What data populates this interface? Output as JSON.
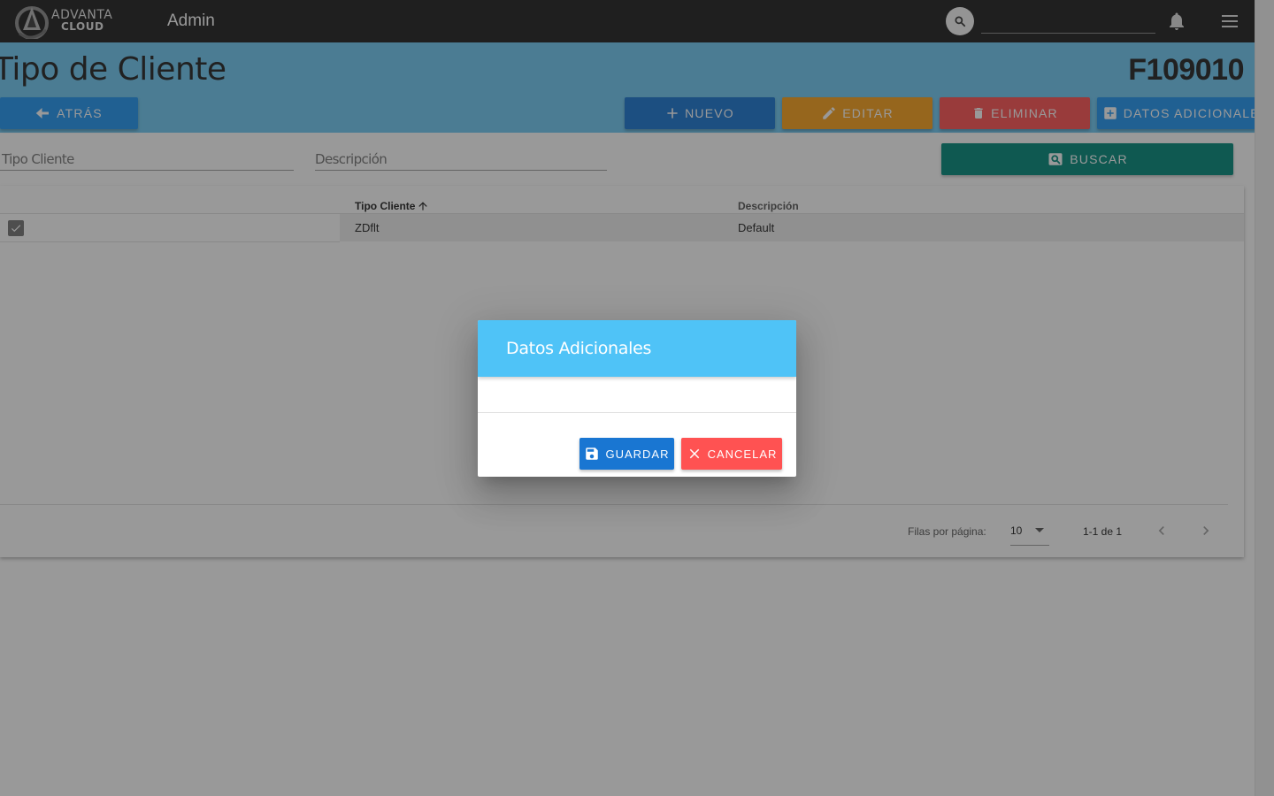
{
  "topbar": {
    "logo_line1": "ADVANTA",
    "logo_line2": "CLOUD",
    "app_title": "Admin",
    "search_value": "",
    "icons": [
      "search-icon",
      "bell-icon",
      "menu-icon"
    ]
  },
  "header": {
    "page_title": "Tipo de Cliente",
    "form_code": "F109010",
    "buttons": {
      "back": "ATRÁS",
      "new": "NUEVO",
      "edit": "EDITAR",
      "delete": "ELIMINAR",
      "additional_data": "DATOS ADICIONALES"
    }
  },
  "filters": {
    "tipo_cliente_placeholder": "Tipo Cliente",
    "descripcion_placeholder": "Descripción",
    "search_button": "BUSCAR"
  },
  "table": {
    "columns": [
      "Tipo Cliente",
      "Descripción"
    ],
    "rows": [
      {
        "selected": true,
        "tipo_cliente": "ZDflt",
        "descripcion": "Default"
      }
    ],
    "footer": {
      "rows_per_page_label": "Filas por página:",
      "rows_per_page_value": "10",
      "range_text": "1-1 de 1"
    }
  },
  "dialog": {
    "title": "Datos Adicionales",
    "save_label": "GUARDAR",
    "cancel_label": "CANCELAR"
  },
  "colors": {
    "topbar": "#1e1e1e",
    "header_band": "#6fc9f4",
    "primary_blue": "#1976d2",
    "light_blue": "#2196f3",
    "orange": "#f9a11b",
    "red": "#ff5252",
    "teal": "#00897b",
    "dialog_header": "#4fc3f7"
  }
}
